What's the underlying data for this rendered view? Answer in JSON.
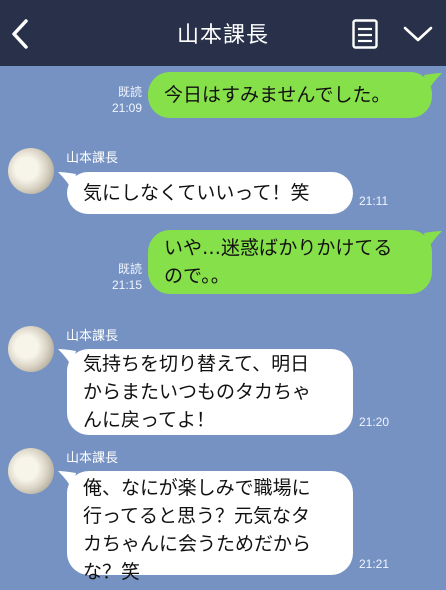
{
  "header": {
    "title": "山本課長",
    "back_icon": "chevron-left-icon",
    "menu_icon": "note-list-icon",
    "more_icon": "chevron-down-icon"
  },
  "messages": [
    {
      "side": "sent",
      "text": "今日はすみませんでした。",
      "read": "既読",
      "time": "21:09"
    },
    {
      "side": "recv",
      "sender": "山本課長",
      "text": "気にしなくていいって！笑",
      "time": "21:11"
    },
    {
      "side": "sent",
      "text": "いや…迷惑ばかりかけてる\nので。。",
      "read": "既読",
      "time": "21:15"
    },
    {
      "side": "recv",
      "sender": "山本課長",
      "text": "気持ちを切り替えて、明日\nからまたいつものタカちゃ\nんに戻ってよ！",
      "time": "21:20"
    },
    {
      "side": "recv",
      "sender": "山本課長",
      "text": "俺、なにが楽しみで職場に\n行ってると思う？元気なタ\nカちゃんに会うためだから\nな？笑",
      "time": "21:21"
    }
  ],
  "colors": {
    "background": "#7592c2",
    "header": "#283149",
    "sent_bubble": "#86e04a",
    "recv_bubble": "#ffffff"
  }
}
